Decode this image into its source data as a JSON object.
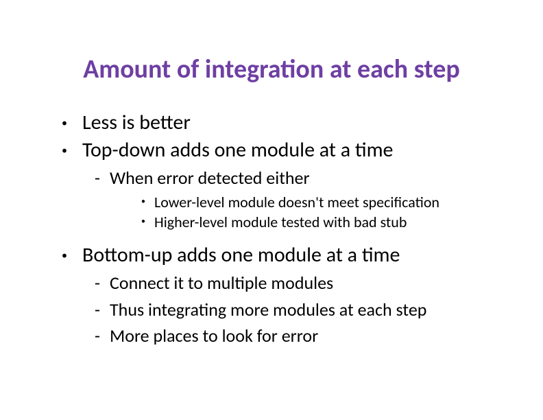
{
  "title": "Amount of integration at each step",
  "bullets": {
    "b1": "Less is better",
    "b2": "Top-down adds one module at a time",
    "b2_1": "When error detected either",
    "b2_1_1": "Lower-level module doesn't meet specification",
    "b2_1_2": "Higher-level module tested with bad stub",
    "b3": "Bottom-up adds one module at a time",
    "b3_1": "Connect it to multiple modules",
    "b3_2": "Thus integrating more modules at each step",
    "b3_3": "More places to look for error"
  }
}
